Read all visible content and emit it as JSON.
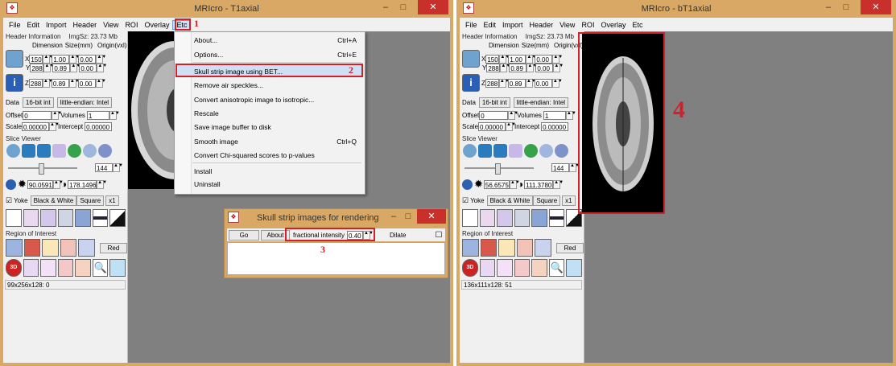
{
  "left_window": {
    "title": "MRIcro - T1axial",
    "menu": [
      "File",
      "Edit",
      "Import",
      "Header",
      "View",
      "ROI",
      "Overlay",
      "Etc"
    ],
    "header_info": "Header Information",
    "img_size": "ImgSz: 23.73 Mb",
    "col_dimension": "Dimension",
    "col_size": "Size(mm)",
    "col_origin": "Origin(vxl)",
    "dims": [
      {
        "axis": "X",
        "dim": "150",
        "size": "1.00",
        "origin": "0.00"
      },
      {
        "axis": "Y",
        "dim": "288",
        "size": "0.89",
        "origin": "0.00"
      },
      {
        "axis": "Z",
        "dim": "288",
        "size": "0.89",
        "origin": "0.00"
      }
    ],
    "data_label": "Data",
    "data_type": "16-bit int",
    "endian": "little-endian: Intel",
    "offset_label": "Offset",
    "offset_value": "0",
    "volumes_label": "Volumes",
    "volumes_value": "1",
    "scale_label": "Scale",
    "scale_value": "0.00000",
    "intercept_label": "Intercept",
    "intercept_value": "0.00000",
    "slice_viewer": "Slice Viewer",
    "slice_value": "144",
    "contrast_min": "90.0591",
    "contrast_max": "178.1496",
    "yoke": "Yoke",
    "colormap": "Black & White",
    "square": "Square",
    "zoom": "x1",
    "roi_label": "Region of Interest",
    "red_button": "Red",
    "status": "99x256x128: 0"
  },
  "etc_menu": {
    "items": [
      {
        "label": "About...",
        "shortcut": "Ctrl+A"
      },
      {
        "label": "Options...",
        "shortcut": "Ctrl+E"
      },
      {
        "label": "Skull strip image using BET...",
        "shortcut": ""
      },
      {
        "label": "Remove air speckles...",
        "shortcut": ""
      },
      {
        "label": "Convert anisotropic image to isotropic...",
        "shortcut": ""
      },
      {
        "label": "Rescale",
        "shortcut": ""
      },
      {
        "label": "Save image buffer to disk",
        "shortcut": ""
      },
      {
        "label": "Smooth image",
        "shortcut": "Ctrl+Q"
      },
      {
        "label": "Convert Chi-squared scores to p-values",
        "shortcut": ""
      },
      {
        "label": "Install",
        "shortcut": ""
      },
      {
        "label": "Uninstall",
        "shortcut": ""
      }
    ]
  },
  "dialog": {
    "title": "Skull strip images for rendering",
    "go": "Go",
    "about": "About",
    "fi_label": "fractional intensity",
    "fi_value": "0.40",
    "dilate": "Dilate"
  },
  "right_window": {
    "title": "MRIcro - bT1axial",
    "menu": [
      "File",
      "Edit",
      "Import",
      "Header",
      "View",
      "ROI",
      "Overlay",
      "Etc"
    ],
    "header_info": "Header Information",
    "img_size": "ImgSz: 23.73 Mb",
    "col_dimension": "Dimension",
    "col_size": "Size(mm)",
    "col_origin": "Origin(vxl)",
    "dims": [
      {
        "axis": "X",
        "dim": "150",
        "size": "1.00",
        "origin": "0.00"
      },
      {
        "axis": "Y",
        "dim": "288",
        "size": "0.89",
        "origin": "0.00"
      },
      {
        "axis": "Z",
        "dim": "288",
        "size": "0.89",
        "origin": "0.00"
      }
    ],
    "data_label": "Data",
    "data_type": "16-bit int",
    "endian": "little-endian: Intel",
    "offset_label": "Offset",
    "offset_value": "0",
    "volumes_label": "Volumes",
    "volumes_value": "1",
    "scale_label": "Scale",
    "scale_value": "0.00000",
    "intercept_label": "Intercept",
    "intercept_value": "0.00000",
    "slice_viewer": "Slice Viewer",
    "slice_value": "144",
    "contrast_min": "56.6575",
    "contrast_max": "111.3780",
    "yoke": "Yoke",
    "colormap": "Black & White",
    "square": "Square",
    "zoom": "x1",
    "roi_label": "Region of Interest",
    "red_button": "Red",
    "status": "136x111x128: 51"
  },
  "annotations": {
    "n1": "1",
    "n2": "2",
    "n3": "3",
    "n4": "4"
  },
  "colors": {
    "title_bar": "#d8a864",
    "highlight_red": "#d0202a",
    "close_red": "#c9302c",
    "viewer_bg": "#808080"
  }
}
